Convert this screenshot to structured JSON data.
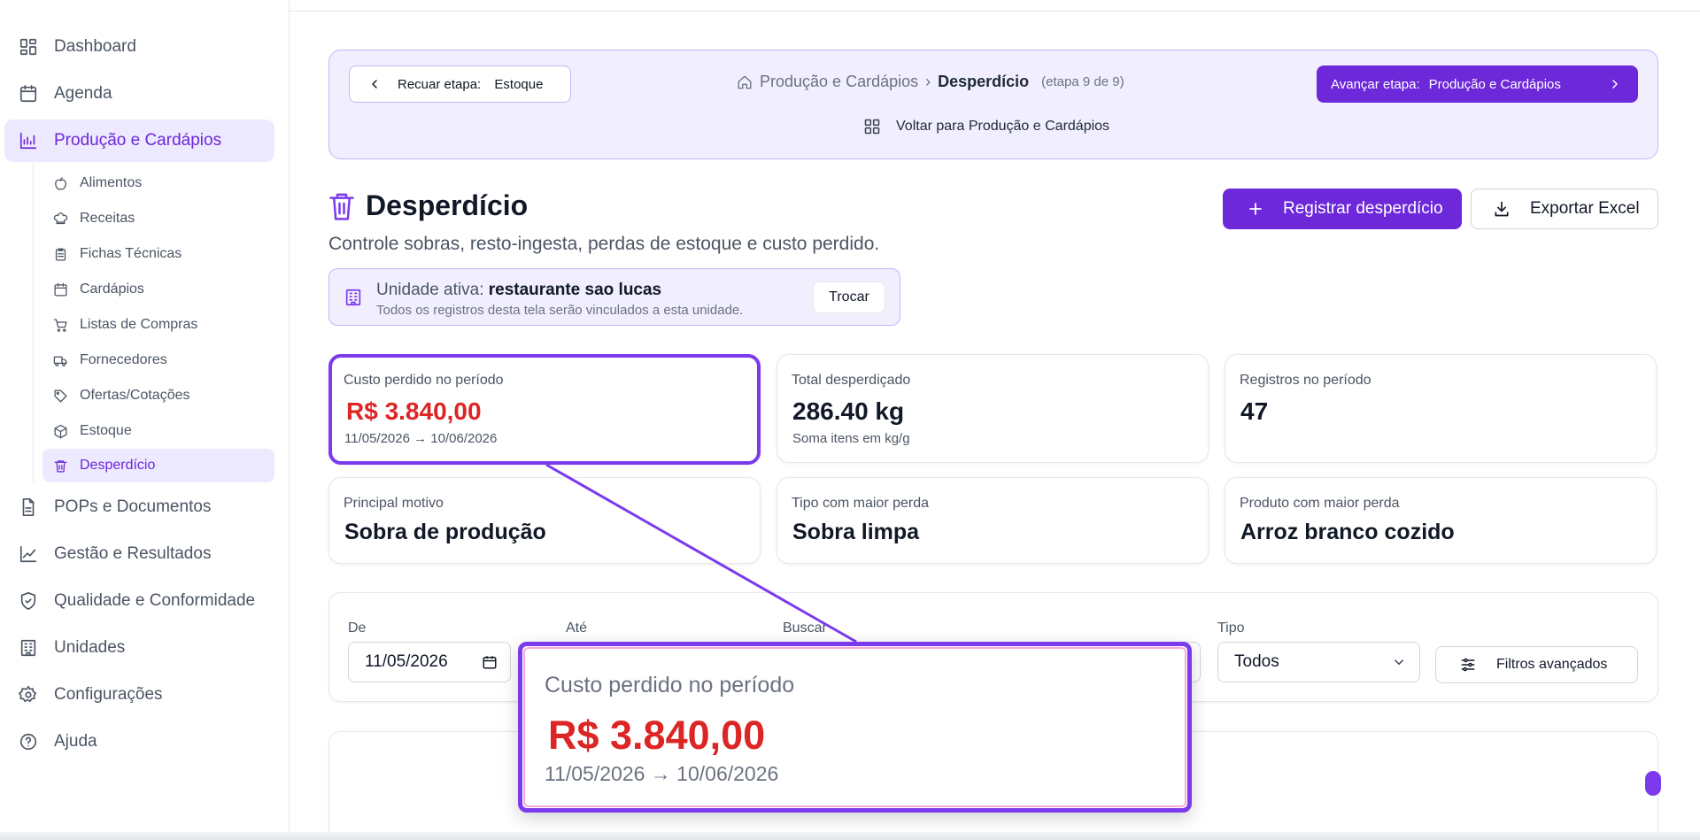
{
  "colors": {
    "accent": "#6d28d9",
    "accent_soft": "#ede9fe",
    "danger": "#dc2626"
  },
  "sidebar": {
    "items": [
      {
        "label": "Dashboard",
        "icon": "dashboard-icon"
      },
      {
        "label": "Agenda",
        "icon": "calendar-icon"
      },
      {
        "label": "Produção e Cardápios",
        "icon": "chart-icon",
        "active": true
      },
      {
        "label": "POPs e Documentos",
        "icon": "document-icon"
      },
      {
        "label": "Gestão e Resultados",
        "icon": "trend-icon"
      },
      {
        "label": "Qualidade e Conformidade",
        "icon": "shield-check-icon"
      },
      {
        "label": "Unidades",
        "icon": "building-icon"
      },
      {
        "label": "Configurações",
        "icon": "gear-icon"
      },
      {
        "label": "Ajuda",
        "icon": "help-icon"
      }
    ],
    "subitems": [
      {
        "label": "Alimentos",
        "icon": "apple-icon"
      },
      {
        "label": "Receitas",
        "icon": "chef-hat-icon"
      },
      {
        "label": "Fichas Técnicas",
        "icon": "clipboard-icon"
      },
      {
        "label": "Cardápios",
        "icon": "calendar-icon"
      },
      {
        "label": "Listas de Compras",
        "icon": "cart-icon"
      },
      {
        "label": "Fornecedores",
        "icon": "truck-icon"
      },
      {
        "label": "Ofertas/Cotações",
        "icon": "tag-icon"
      },
      {
        "label": "Estoque",
        "icon": "package-icon"
      },
      {
        "label": "Desperdício",
        "icon": "trash-icon",
        "active": true
      }
    ]
  },
  "stepper": {
    "back_label": "Recuar etapa:",
    "back_target": "Estoque",
    "crumb_parent": "Produção e Cardápios",
    "crumb_sep": "›",
    "crumb_current": "Desperdício",
    "step_info": "(etapa 9 de 9)",
    "next_label": "Avançar etapa:",
    "next_target": "Produção e Cardápios",
    "return_link": "Voltar para Produção e Cardápios"
  },
  "page": {
    "title": "Desperdício",
    "subtitle": "Controle sobras, resto-ingesta, perdas de estoque e custo perdido.",
    "register_button": "Registrar desperdício",
    "export_button": "Exportar Excel"
  },
  "unit": {
    "prefix": "Unidade ativa:",
    "name": "restaurante sao lucas",
    "note": "Todos os registros desta tela serão vinculados a esta unidade.",
    "change_button": "Trocar"
  },
  "stats": {
    "cost": {
      "label": "Custo perdido no período",
      "value": "R$ 3.840,00",
      "note": "11/05/2026 → 10/06/2026"
    },
    "total": {
      "label": "Total desperdiçado",
      "value": "286.40 kg",
      "note": "Soma itens em kg/g"
    },
    "records": {
      "label": "Registros no período",
      "value": "47"
    },
    "reason": {
      "label": "Principal motivo",
      "value": "Sobra de produção"
    },
    "type": {
      "label": "Tipo com maior perda",
      "value": "Sobra limpa"
    },
    "product": {
      "label": "Produto com maior perda",
      "value": "Arroz branco cozido"
    }
  },
  "filters": {
    "from_label": "De",
    "from_value": "11/05/2026",
    "to_label": "Até",
    "search_label": "Buscar",
    "type_label": "Tipo",
    "type_value": "Todos",
    "advanced_button": "Filtros avançados"
  },
  "zoom": {
    "label": "Custo perdido no período",
    "value": "R$ 3.840,00",
    "note": "11/05/2026 → 10/06/2026"
  }
}
